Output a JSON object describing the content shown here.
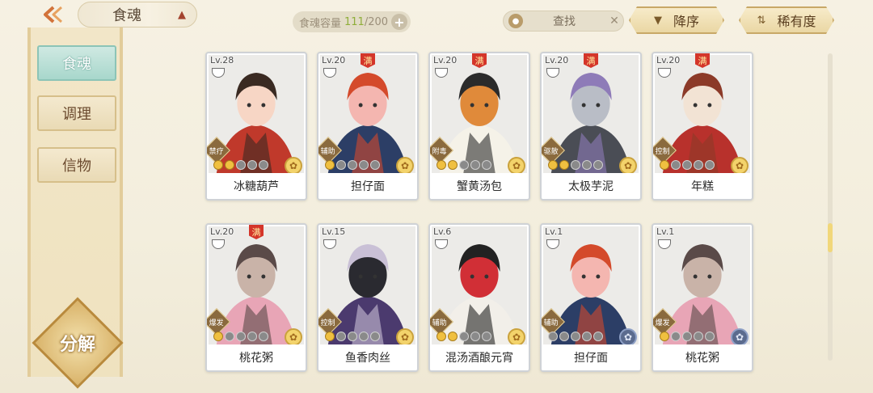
{
  "header": {
    "back_icon": "back-arrow-icon",
    "title": "食魂",
    "capacity_label": "食魂容量",
    "capacity_current": "111",
    "capacity_sep_total": "/200",
    "capacity_add": "+",
    "search_placeholder": "查找",
    "search_clear": "✕",
    "sort_label": "降序",
    "rarity_label": "稀有度"
  },
  "sidebar": {
    "tabs": [
      {
        "label": "食魂",
        "active": true
      },
      {
        "label": "调理",
        "active": false
      },
      {
        "label": "信物",
        "active": false
      }
    ],
    "decompose_label": "分解"
  },
  "colors": {
    "accent": "#d2733a",
    "active_tab": "#a8d7cc",
    "card_border": "#cfd2d6",
    "star_on": "#f0c040"
  },
  "cards": [
    {
      "level": "Lv.28",
      "full": false,
      "role": "禁疗",
      "stars_on": 2,
      "gem": "light",
      "name": "冰糖葫芦",
      "palette": [
        "#c0392b",
        "#f7d6c5",
        "#3a2a22"
      ]
    },
    {
      "level": "Lv.20",
      "full": true,
      "full_label": "满",
      "role": "辅助",
      "stars_on": 1,
      "gem": "light",
      "name": "担仔面",
      "palette": [
        "#2c3e66",
        "#f4b6b0",
        "#d44a2b"
      ]
    },
    {
      "level": "Lv.20",
      "full": true,
      "full_label": "满",
      "role": "附毒",
      "stars_on": 2,
      "gem": "light",
      "name": "蟹黄汤包",
      "palette": [
        "#f5f2e8",
        "#e08a3a",
        "#2b2b2b"
      ]
    },
    {
      "level": "Lv.20",
      "full": true,
      "full_label": "满",
      "role": "驱散",
      "stars_on": 2,
      "gem": "light",
      "name": "太极芋泥",
      "palette": [
        "#4a4d55",
        "#b9bdc6",
        "#8e7bb8"
      ]
    },
    {
      "level": "Lv.20",
      "full": true,
      "full_label": "满",
      "role": "控制",
      "stars_on": 1,
      "gem": "light",
      "name": "年糕",
      "palette": [
        "#b8312c",
        "#f2e3d4",
        "#8c3a28"
      ]
    },
    {
      "level": "Lv.20",
      "full": true,
      "full_label": "满",
      "role": "爆发",
      "stars_on": 1,
      "gem": "light",
      "name": "桃花粥",
      "palette": [
        "#e8a5b6",
        "#c9b3a8",
        "#5a4a48"
      ]
    },
    {
      "level": "Lv.15",
      "full": false,
      "role": "控制",
      "stars_on": 1,
      "gem": "light",
      "name": "鱼香肉丝",
      "palette": [
        "#4b3a6e",
        "#2a2a30",
        "#c9c0d6"
      ]
    },
    {
      "level": "Lv.6",
      "full": false,
      "role": "辅助",
      "stars_on": 2,
      "gem": "light",
      "name": "混汤酒酿元宵",
      "palette": [
        "#f2efe9",
        "#d12f36",
        "#222"
      ]
    },
    {
      "level": "Lv.1",
      "full": false,
      "role": "辅助",
      "stars_on": 0,
      "gem": "dark",
      "name": "担仔面",
      "palette": [
        "#2c3e66",
        "#f4b6b0",
        "#d44a2b"
      ]
    },
    {
      "level": "Lv.1",
      "full": false,
      "role": "爆发",
      "stars_on": 1,
      "gem": "dark",
      "name": "桃花粥",
      "palette": [
        "#e8a5b6",
        "#c9b3a8",
        "#5a4a48"
      ]
    }
  ]
}
